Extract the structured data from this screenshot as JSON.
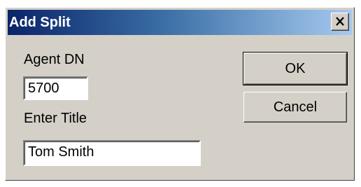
{
  "window": {
    "title": "Add Split",
    "close_icon": "close-icon"
  },
  "form": {
    "agent_dn_label": "Agent DN",
    "agent_dn_value": "5700",
    "title_label": "Enter Title",
    "title_value": "Tom Smith"
  },
  "buttons": {
    "ok_label": "OK",
    "cancel_label": "Cancel"
  },
  "colors": {
    "titlebar_start": "#0a246a",
    "titlebar_end": "#a6caf0",
    "dialog_background": "#d4d0c8"
  }
}
